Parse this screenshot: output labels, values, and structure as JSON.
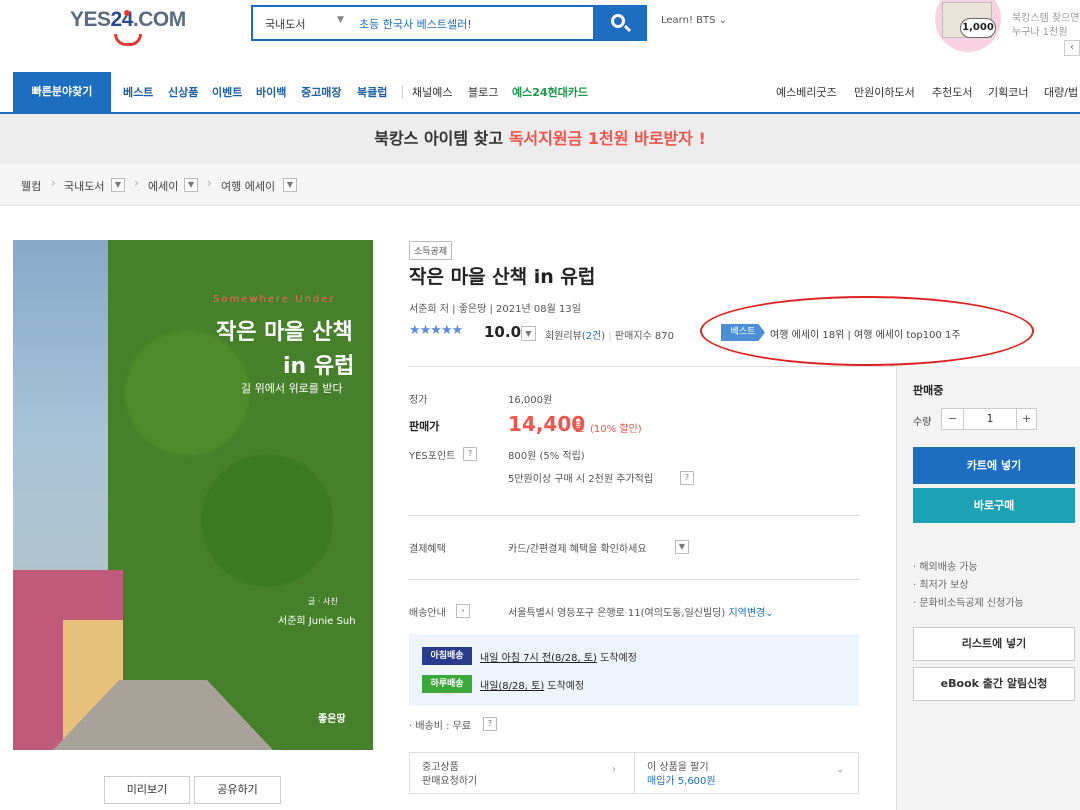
{
  "header": {
    "logo_left": "YES",
    "logo_num": "24",
    "logo_right": ".COM",
    "search_category": "국내도서",
    "search_query": "초등 한국사 베스트셀러!",
    "learn_link": "Learn! BTS ⌄",
    "promo_badge": "1,000",
    "promo_line1": "북캉스템 찾으면",
    "promo_line2": "누구나 1천원",
    "promo_arrow": "‹"
  },
  "nav": {
    "find": "빠른분야찾기",
    "items": [
      "베스트",
      "신상품",
      "이벤트",
      "바이백",
      "중고매장",
      "북클럽"
    ],
    "items2": [
      "채널예스",
      "블로그"
    ],
    "card": "예스24현대카드",
    "right": [
      "예스베리굿즈",
      "만원이하도서",
      "추천도서",
      "기획코너",
      "대량/법"
    ]
  },
  "banner": {
    "before": "북캉스 아이템 찾고 ",
    "highlight": "독서지원금 1천원 바로받자 !"
  },
  "breadcrumb": [
    "웰컴",
    "국내도서",
    "에세이",
    "여행 에세이"
  ],
  "cover": {
    "sub_en": "Somewhere Under",
    "title1": "작은 마을 산책",
    "title2": "in 유럽",
    "tagline": "길 위에서 위로를 받다",
    "author_role": "글 · 사진",
    "author": "서준희 Junie Suh",
    "publisher": "좋은땅"
  },
  "cover_buttons": {
    "preview": "미리보기",
    "share": "공유하기"
  },
  "product": {
    "badge": "소득공제",
    "title": "작은 마을 산책 in 유럽",
    "meta": "서준희 저  |  좋은땅  |  2021년 08월 13일",
    "rating": "10.0",
    "reviews_label": "회원리뷰(",
    "reviews_count": "2건",
    "reviews_close": ")",
    "sales_index": "판매지수 870",
    "best_tag": "베스트",
    "best_rank": "여행 에세이 18위  |  여행 에세이 top100 1주"
  },
  "price": {
    "list_label": "정가",
    "list_value": "16,000원",
    "sale_label": "판매가",
    "sale_value": "14,400",
    "sale_unit": "원",
    "discount": "(10% 할인)",
    "points_label": "YES포인트",
    "points_value": "800원 (5% 적립)",
    "extra_points": "5만원이상 구매 시 2천원 추가적립",
    "benefit_label": "결제혜택",
    "benefit_value": "카드/간편결제 혜택을 확인하세요",
    "ship_label": "배송안내",
    "ship_address": "서울특별시 영등포구 은행로 11(여의도동,일신빌딩)",
    "ship_change": "지역변경"
  },
  "delivery": {
    "morning_tag": "아침배송",
    "morning_text": "내일 아침 7시 전(8/28, 토)",
    "morning_suffix": " 도착예정",
    "sameday_tag": "하루배송",
    "sameday_text": "내일(8/28, 토)",
    "sameday_suffix": " 도착예정",
    "fee": "· 배송비 : 무료"
  },
  "used": {
    "left1": "중고상품",
    "left2": "판매요청하기",
    "right1": "이 상품을 팔기",
    "right2": "매입가 5,600원"
  },
  "sidebar": {
    "status": "판매중",
    "qty_label": "수량",
    "qty_value": "1",
    "minus": "−",
    "plus": "+",
    "cart": "카트에 넣기",
    "buy": "바로구매",
    "bullets": [
      "· 해외배송 가능",
      "· 최저가 보상",
      "· 문화비소득공제 신청가능"
    ],
    "list_btn": "리스트에 넣기",
    "ebook_btn": "eBook 출간 알림신청"
  },
  "colors": {
    "brand": "#1d6ec0",
    "sale": "#f0544c",
    "teal": "#1ba2b4",
    "highlight_ring": "#e02020"
  },
  "icons": [
    "search-icon",
    "chevron-down-icon",
    "star-icon",
    "chevron-right-icon",
    "question-icon"
  ]
}
